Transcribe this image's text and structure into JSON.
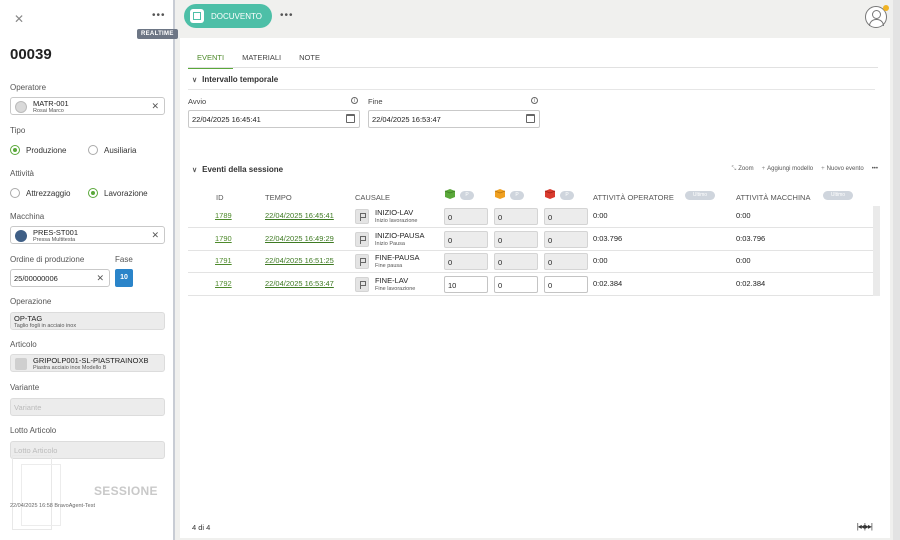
{
  "left": {
    "more": "•••",
    "realtime": "REALTIME",
    "session_id": "00039",
    "operatore": {
      "label": "Operatore",
      "code": "MATR-001",
      "name": "Rosai Marco"
    },
    "tipo": {
      "label": "Tipo",
      "options": [
        "Produzione",
        "Ausiliaria"
      ],
      "selected": "Produzione"
    },
    "attivita": {
      "label": "Attività",
      "options": [
        "Attrezzaggio",
        "Lavorazione"
      ],
      "selected": "Lavorazione"
    },
    "macchina": {
      "label": "Macchina",
      "code": "PRES-ST001",
      "name": "Pressa Multitesta"
    },
    "ordine": {
      "label": "Ordine di produzione",
      "value": "25/00000006"
    },
    "fase": {
      "label": "Fase",
      "value": "10"
    },
    "operazione": {
      "label": "Operazione",
      "code": "OP-TAG",
      "desc": "Taglio fogli in acciaio inox"
    },
    "articolo": {
      "label": "Articolo",
      "code": "GRIPOLP001-SL-PIASTRAINOXB",
      "desc": "Piastra acciaio inox Modello B"
    },
    "variante": {
      "label": "Variante",
      "placeholder": "Variante"
    },
    "lotto": {
      "label": "Lotto Articolo",
      "placeholder": "Lotto Articolo"
    },
    "watermark": "SESSIONE",
    "footer": "22/04/2025 16:58 BravoAgent-Test"
  },
  "topbar": {
    "doc_label": "DOCUVENTO",
    "more": "•••"
  },
  "tabs": [
    "EVENTI",
    "MATERIALI",
    "NOTE"
  ],
  "interval": {
    "title": "Intervallo temporale",
    "avvio_label": "Avvio",
    "avvio_value": "22/04/2025 16:45:41",
    "fine_label": "Fine",
    "fine_value": "22/04/2025 16:53:47"
  },
  "events": {
    "title": "Eventi della sessione",
    "toolbar": [
      "Zoom",
      "Aggiungi modello",
      "Nuovo evento",
      "•••"
    ],
    "columns": {
      "id": "ID",
      "tempo": "TEMPO",
      "causale": "CAUSALE",
      "badge": "P",
      "att_op": "ATTIVITÀ OPERATORE",
      "att_mac": "ATTIVITÀ MACCHINA",
      "pill_op": "Ultimo",
      "pill_mac": "Ultimo"
    },
    "rows": [
      {
        "id": "1789",
        "tempo": "22/04/2025 16:45:41",
        "causale": "INIZIO-LAV",
        "sub": "Inizio lavorazione",
        "good": "0",
        "scrap1": "0",
        "scrap2": "0",
        "op": "0:00",
        "mac": "0:00",
        "editable": false
      },
      {
        "id": "1790",
        "tempo": "22/04/2025 16:49:29",
        "causale": "INIZIO-PAUSA",
        "sub": "Inizio Pausa",
        "good": "0",
        "scrap1": "0",
        "scrap2": "0",
        "op": "0:03.796",
        "mac": "0:03.796",
        "editable": false
      },
      {
        "id": "1791",
        "tempo": "22/04/2025 16:51:25",
        "causale": "FINE-PAUSA",
        "sub": "Fine pausa",
        "good": "0",
        "scrap1": "0",
        "scrap2": "0",
        "op": "0:00",
        "mac": "0:00",
        "editable": false
      },
      {
        "id": "1792",
        "tempo": "22/04/2025 16:53:47",
        "causale": "FINE-LAV",
        "sub": "Fine lavorazione",
        "good": "10",
        "scrap1": "0",
        "scrap2": "0",
        "op": "0:02.384",
        "mac": "0:02.384",
        "editable": true
      }
    ],
    "count": "4 di 4",
    "pager": "|◂◂|▸▸|"
  },
  "colors": {
    "accent": "#5aa83a",
    "doc_button": "#4dbfa7",
    "fase": "#2a84c9",
    "cube_good": "#5aa83a",
    "cube_warn": "#f0a020",
    "cube_bad": "#d93a2e"
  }
}
